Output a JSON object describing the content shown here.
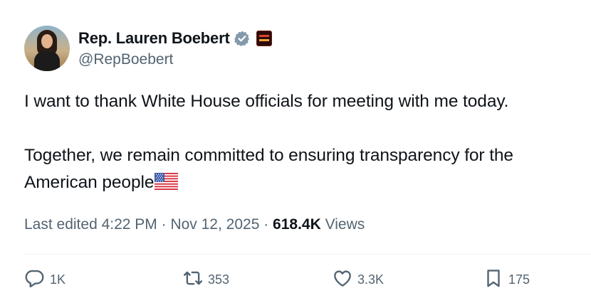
{
  "author": {
    "display_name": "Rep. Lauren Boebert",
    "handle": "@RepBoebert"
  },
  "tweet": {
    "paragraph1": "I want to thank White House officials for meeting with me today.",
    "paragraph2": "Together, we remain committed to ensuring transparency for the American people"
  },
  "meta": {
    "edited_label": "Last edited 4:22 PM · Nov 12, 2025 ·",
    "views_count": "618.4K",
    "views_label": "Views"
  },
  "actions": {
    "replies": "1K",
    "reposts": "353",
    "likes": "3.3K",
    "bookmarks": "175"
  },
  "icons": {
    "verified": "verified-badge-icon",
    "affiliation": "affiliation-badge-icon",
    "flag": "us-flag-emoji",
    "reply": "reply-icon",
    "repost": "repost-icon",
    "like": "heart-icon",
    "bookmark": "bookmark-icon"
  },
  "colors": {
    "text": "#0f1419",
    "secondary": "#536471",
    "verified_badge": "#829aab",
    "divider": "#eff3f4"
  }
}
